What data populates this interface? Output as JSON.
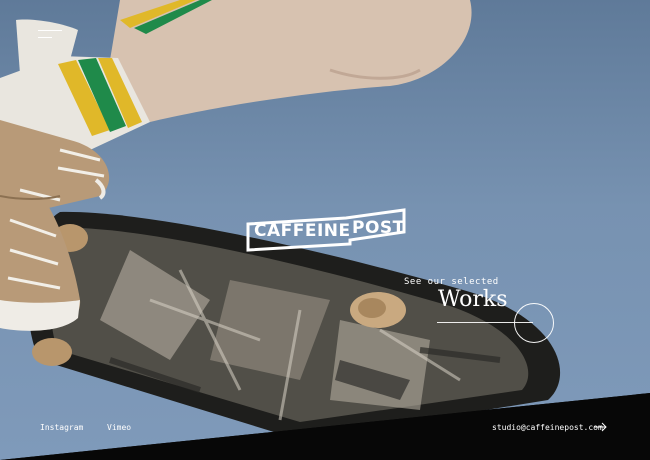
{
  "brand": {
    "logo_word_1": "CAFFEINE",
    "logo_word_2": "POST"
  },
  "hero": {
    "kicker": "See our selected",
    "title": "Works"
  },
  "footer": {
    "links": [
      "Instagram",
      "Vimeo"
    ],
    "email": "studio@caffeinepost.com"
  },
  "icons": {
    "menu": "hamburger-menu-icon",
    "works": "circle-arrow-icon",
    "email": "arrow-right-icon"
  },
  "colors": {
    "sky": "#7792b1",
    "text": "#ffffff",
    "band": "#070707",
    "sock_yellow": "#e0b829",
    "sock_green": "#1f8a4a",
    "shoe": "#b89a78",
    "skin": "#d8c4b4"
  }
}
